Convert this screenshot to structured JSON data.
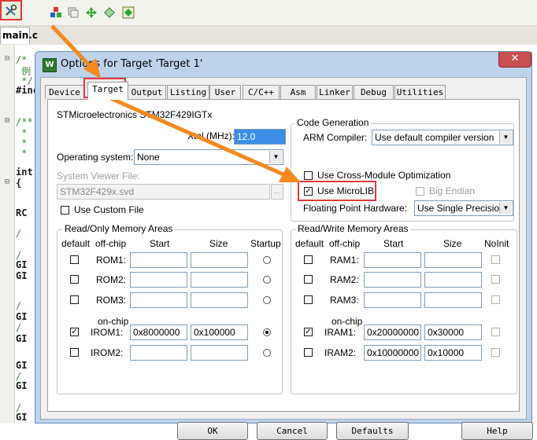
{
  "ide": {
    "toolbar_icons": [
      "options-for-target-icon",
      "manage-project-icon",
      "copy-icon",
      "move-icon",
      "select-device-icon",
      "batch-build-icon"
    ],
    "file_tab": "main.c",
    "code_lines": [
      {
        "gutter": "⊟",
        "text": "/*"
      },
      {
        "gutter": "",
        "text": " 例"
      },
      {
        "gutter": "",
        "text": " */"
      },
      {
        "gutter": "",
        "text": "#inc"
      },
      {
        "gutter": "⊟",
        "text": "/**"
      },
      {
        "gutter": "",
        "text": " *"
      },
      {
        "gutter": "",
        "text": " *"
      },
      {
        "gutter": "",
        "text": " *"
      },
      {
        "gutter": "",
        "text": "int"
      },
      {
        "gutter": "⊟",
        "text": "{"
      },
      {
        "gutter": "",
        "text": "RC"
      },
      {
        "gutter": "",
        "text": "/"
      },
      {
        "gutter": "",
        "text": "/"
      },
      {
        "gutter": "",
        "text": "GI"
      },
      {
        "gutter": "",
        "text": "GI"
      },
      {
        "gutter": "",
        "text": "/"
      },
      {
        "gutter": "",
        "text": "GI"
      },
      {
        "gutter": "",
        "text": "/"
      },
      {
        "gutter": "",
        "text": "GI"
      },
      {
        "gutter": "",
        "text": "GI"
      },
      {
        "gutter": "",
        "text": "/"
      },
      {
        "gutter": "",
        "text": "GI"
      },
      {
        "gutter": "",
        "text": "/"
      },
      {
        "gutter": "",
        "text": "GI"
      }
    ]
  },
  "dialog": {
    "title": "Options for Target 'Target 1'",
    "title_hidden_part": "ns",
    "close_symbol": "✕",
    "tabs": [
      {
        "label": "Device",
        "active": false
      },
      {
        "label": "Target",
        "active": true
      },
      {
        "label": "Output",
        "active": false
      },
      {
        "label": "Listing",
        "active": false
      },
      {
        "label": "User",
        "active": false
      },
      {
        "label": "C/C++",
        "active": false
      },
      {
        "label": "Asm",
        "active": false
      },
      {
        "label": "Linker",
        "active": false
      },
      {
        "label": "Debug",
        "active": false
      },
      {
        "label": "Utilities",
        "active": false
      }
    ],
    "device_name": "STMicroelectronics STM32F429IGTx",
    "xtal_label": "Xtal (MHz):",
    "xtal_value": "12.0",
    "os_label": "Operating system:",
    "os_value": "None",
    "svf_label": "System Viewer File:",
    "svf_value": "STM32F429x.svd",
    "svf_browse": "...",
    "custom_file_label": "Use Custom File",
    "custom_file_checked": false,
    "codegen": {
      "title": "Code Generation",
      "compiler_label": "ARM Compiler:",
      "compiler_value": "Use default compiler version",
      "cross_module_label": "Use Cross-Module Optimization",
      "cross_module_checked": false,
      "microlib_label": "Use MicroLIB",
      "microlib_checked": true,
      "big_endian_label": "Big Endian",
      "big_endian_checked": false,
      "fp_label": "Floating Point Hardware:",
      "fp_value": "Use Single Precision"
    },
    "rom": {
      "title": "Read/Only Memory Areas",
      "headers": {
        "default": "default",
        "chip": "off-chip",
        "start": "Start",
        "size": "Size",
        "extra": "Startup"
      },
      "onchip_label": "on-chip",
      "rows": [
        {
          "name": "ROM1:",
          "default": false,
          "start": "",
          "size": "",
          "startup": false
        },
        {
          "name": "ROM2:",
          "default": false,
          "start": "",
          "size": "",
          "startup": false
        },
        {
          "name": "ROM3:",
          "default": false,
          "start": "",
          "size": "",
          "startup": false
        },
        {
          "name": "IROM1:",
          "default": true,
          "start": "0x8000000",
          "size": "0x100000",
          "startup": true
        },
        {
          "name": "IROM2:",
          "default": false,
          "start": "",
          "size": "",
          "startup": false
        }
      ]
    },
    "ram": {
      "title": "Read/Write Memory Areas",
      "headers": {
        "default": "default",
        "chip": "off-chip",
        "start": "Start",
        "size": "Size",
        "extra": "NoInit"
      },
      "onchip_label": "on-chip",
      "rows": [
        {
          "name": "RAM1:",
          "default": false,
          "start": "",
          "size": "",
          "noinit": false
        },
        {
          "name": "RAM2:",
          "default": false,
          "start": "",
          "size": "",
          "noinit": false
        },
        {
          "name": "RAM3:",
          "default": false,
          "start": "",
          "size": "",
          "noinit": false
        },
        {
          "name": "IRAM1:",
          "default": true,
          "start": "0x20000000",
          "size": "0x30000",
          "noinit": false
        },
        {
          "name": "IRAM2:",
          "default": false,
          "start": "0x10000000",
          "size": "0x10000",
          "noinit": false
        }
      ]
    },
    "buttons": {
      "ok": "OK",
      "cancel": "Cancel",
      "defaults": "Defaults",
      "help": "Help"
    }
  },
  "colors": {
    "annotation_arrow": "#f58a1f",
    "annotation_box": "#e2383c",
    "dialog_frame": "#bdd3ec"
  }
}
